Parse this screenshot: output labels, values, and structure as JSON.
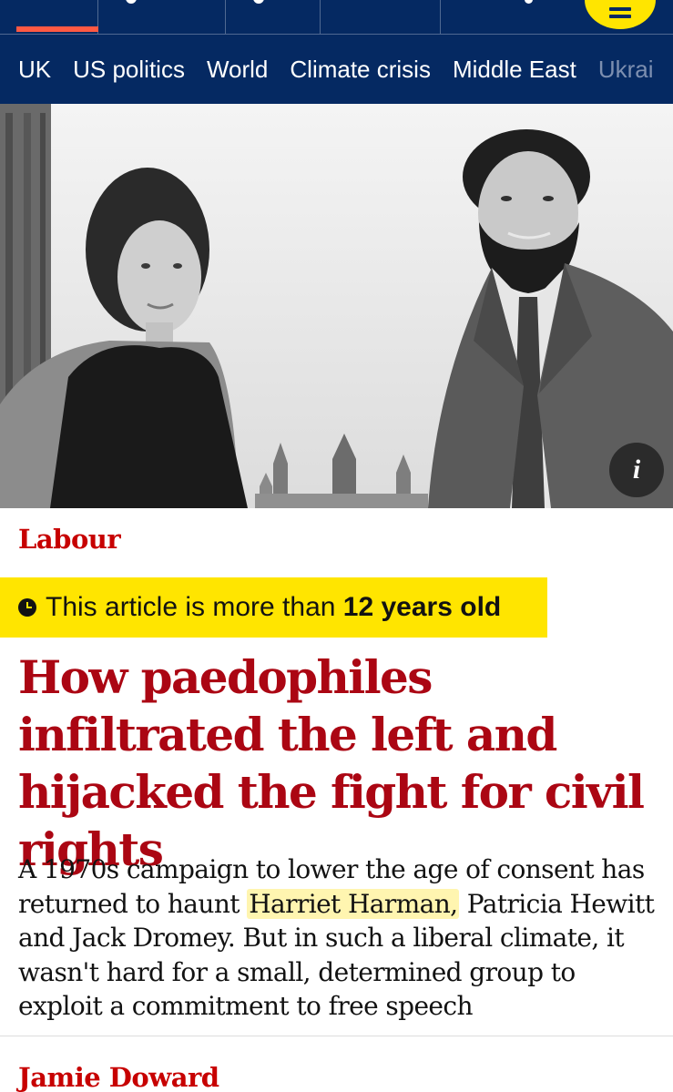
{
  "nav": {
    "subnav_items": [
      "UK",
      "US politics",
      "World",
      "Climate crisis",
      "Middle East"
    ],
    "subnav_overflow": "Ukrai"
  },
  "article": {
    "section": "Labour",
    "age_notice_prefix": "This article is more than",
    "age_notice_age": "12 years old",
    "headline": "How paedophiles infiltrated the left and hijacked the fight for civil rights",
    "standfirst_before": "A 1970s campaign to lower the age of consent has returned to haunt",
    "standfirst_highlight": "Harriet Harman,",
    "standfirst_after": "Patricia Hewitt and Jack Dromey. But in such a liberal climate, it wasn't hard for a small, determined group to exploit a commitment to free speech",
    "byline": "Jamie Doward"
  },
  "colors": {
    "nav_background": "#052962",
    "menu_button": "#ffe500",
    "kicker": "#c70000",
    "headline": "#ab0613",
    "age_banner": "#ffe500"
  },
  "icons": {
    "menu": "menu-icon",
    "info": "info-icon",
    "clock": "clock-icon"
  }
}
